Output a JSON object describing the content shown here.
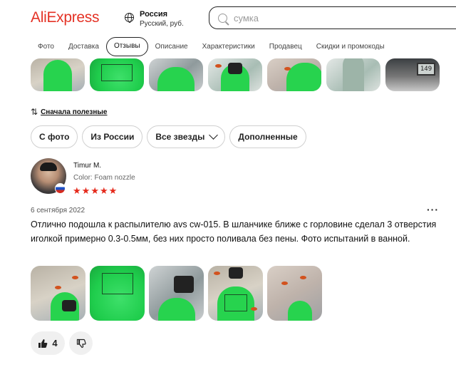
{
  "header": {
    "logo": "AliExpress",
    "region_country": "Россия",
    "region_details": "Русский, руб.",
    "search_placeholder": "сумка"
  },
  "tabs": [
    {
      "label": "Фото",
      "active": false
    },
    {
      "label": "Доставка",
      "active": false
    },
    {
      "label": "Отзывы",
      "active": true
    },
    {
      "label": "Описание",
      "active": false
    },
    {
      "label": "Характеристики",
      "active": false
    },
    {
      "label": "Продавец",
      "active": false
    },
    {
      "label": "Скидки и промокоды",
      "active": false
    }
  ],
  "top_strip_lcd": "149",
  "sort": {
    "label": "Сначала полезные"
  },
  "filters": [
    "С фото",
    "Из России",
    "Все звезды",
    "Дополненные"
  ],
  "review": {
    "author": "Timur M.",
    "variant": "Color: Foam nozzle",
    "rating": 5,
    "date": "6 сентября 2022",
    "text": "Отлично подошла к распылителю avs cw-015. В шланчике ближе с горловине сделал 3 отверстия иголкой примерно 0.3-0.5мм, без них просто поливала без пены. Фото испытаний в ванной.",
    "photo_count": 5,
    "likes": "4"
  },
  "colors": {
    "brand": "#e43225",
    "star": "#e5291b",
    "chip_border": "#d0d0d0"
  }
}
